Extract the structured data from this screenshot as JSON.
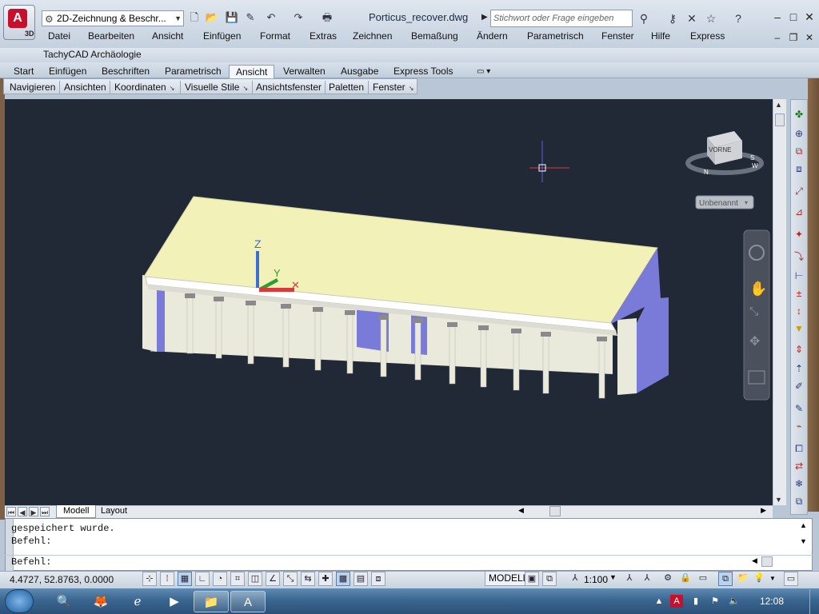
{
  "titlebar": {
    "app_badge": "3D",
    "workspace": "2D-Zeichnung & Beschr...",
    "document_title": "Porticus_recover.dwg",
    "search_placeholder": "Stichwort oder Frage eingeben"
  },
  "menu": [
    "Datei",
    "Bearbeiten",
    "Ansicht",
    "Einfügen",
    "Format",
    "Extras",
    "Zeichnen",
    "Bemaßung",
    "Ändern",
    "Parametrisch",
    "Fenster",
    "Hilfe",
    "Express"
  ],
  "menu2": "TachyCAD Archäologie",
  "ribbon_tabs": [
    "Start",
    "Einfügen",
    "Beschriften",
    "Parametrisch",
    "Ansicht",
    "Verwalten",
    "Ausgabe",
    "Express Tools"
  ],
  "ribbon_active": "Ansicht",
  "ribbon_panels": [
    "Navigieren",
    "Ansichten",
    "Koordinaten",
    "Visuelle Stile",
    "Ansichtsfenster",
    "Paletten",
    "Fenster"
  ],
  "viewport": {
    "viewcube_label": "VORNE",
    "ucs_label": "Unbenannt",
    "axis_z": "Z",
    "axis_y": "Y",
    "compass_n": "N",
    "compass_s": "S",
    "compass_w": "W",
    "colors": {
      "background": "#212836",
      "roof": "#f2f2b8",
      "wall": "#e9e9dc",
      "shadow": "#7a7ad8"
    }
  },
  "layout_tabs": {
    "model": "Modell",
    "layout": "Layout"
  },
  "command": {
    "line1": "gespeichert wurde.",
    "line2": "Befehl:",
    "prompt": "Befehl:"
  },
  "status": {
    "coords": "4.4727, 52.8763, 0.0000",
    "model": "MODELL",
    "scale": "1:100"
  },
  "taskbar": {
    "clock": "12:08"
  }
}
